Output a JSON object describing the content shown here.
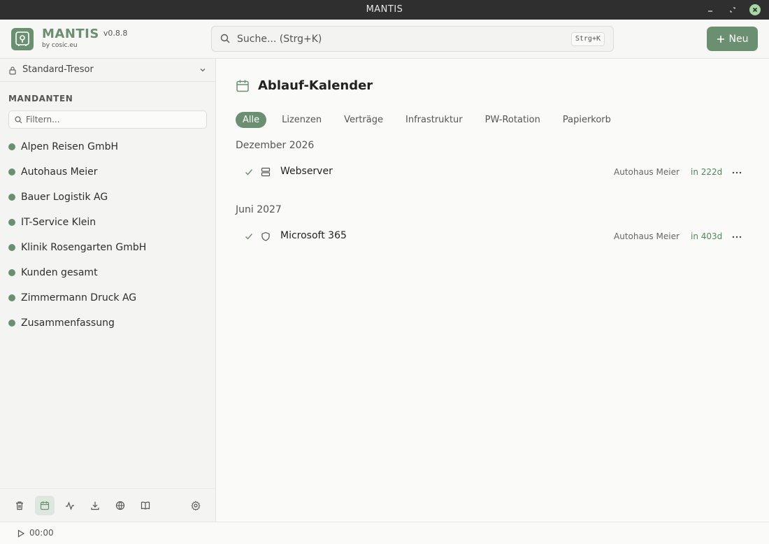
{
  "window": {
    "title": "MANTIS"
  },
  "header": {
    "app_name": "MANTIS",
    "version": "v0.8.8",
    "by": "by cosic.eu",
    "search_placeholder": "Suche... (Strg+K)",
    "search_shortcut": "Strg+K",
    "new_button": "Neu"
  },
  "sidebar": {
    "vault": "Standard-Tresor",
    "section_title": "MANDANTEN",
    "filter_placeholder": "Filtern...",
    "clients": [
      "Alpen Reisen GmbH",
      "Autohaus Meier",
      "Bauer Logistik AG",
      "IT-Service Klein",
      "Klinik Rosengarten GmbH",
      "Kunden gesamt",
      "Zimmermann Druck AG",
      "Zusammenfassung"
    ],
    "tools": [
      "trash-icon",
      "calendar-icon",
      "activity-icon",
      "download-icon",
      "globe-icon",
      "book-icon",
      "gear-icon"
    ]
  },
  "main": {
    "title": "Ablauf-Kalender",
    "tabs": [
      "Alle",
      "Lizenzen",
      "Verträge",
      "Infrastruktur",
      "PW-Rotation",
      "Papierkorb"
    ],
    "active_tab": "Alle",
    "groups": [
      {
        "label": "Dezember 2026",
        "items": [
          {
            "name": "Webserver",
            "kind_icon": "server-icon",
            "client": "Autohaus Meier",
            "due": "in 222d"
          }
        ]
      },
      {
        "label": "Juni 2027",
        "items": [
          {
            "name": "Microsoft 365",
            "kind_icon": "shield-icon",
            "client": "Autohaus Meier",
            "due": "in 403d"
          }
        ]
      }
    ]
  },
  "statusbar": {
    "time": "00:00"
  },
  "colors": {
    "accent": "#6b8f71",
    "due": "#4f8a56"
  }
}
